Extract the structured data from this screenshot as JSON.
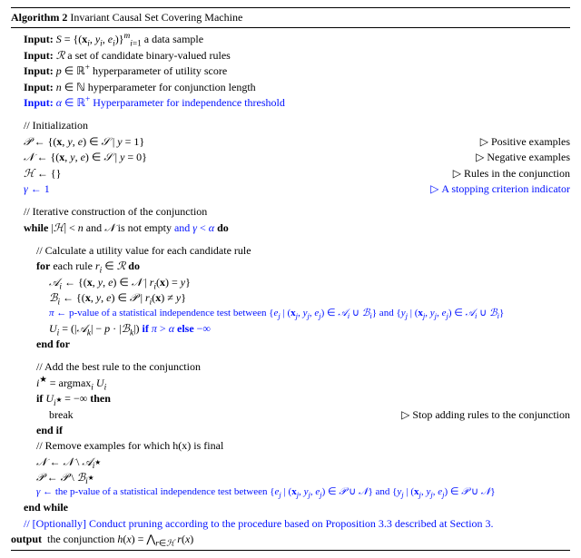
{
  "title_label": "Algorithm 2",
  "title_name": "Invariant Causal Set Covering Machine",
  "inputs": {
    "s": "S = {(xᵢ, yᵢ, eᵢ)}ᵐᵢ₌₁ a data sample",
    "r": "ℛ a set of candidate binary-valued rules",
    "p": "p ∈ ℝ⁺ hyperparameter of utility score",
    "n": "n ∈ ℕ hyperparameter for conjunction length",
    "alpha": "α ∈ ℝ⁺ Hyperparameter for independence threshold"
  },
  "init_comment": "// Initialization",
  "init": {
    "P": "𝒫 ← {(x, y, e) ∈ 𝒮 | y = 1}",
    "N": "𝒩 ← {(x, y, e) ∈ 𝒮 | y = 0}",
    "H": "ℋ ← {}",
    "gamma": "γ ← 1"
  },
  "init_rhs": {
    "P": "Positive examples",
    "N": "Negative examples",
    "H": "Rules in the conjunction",
    "gamma": "A stopping criterion indicator"
  },
  "iter_comment": "// Iterative construction of the conjunction",
  "while_line_a": "while |ℋ| < n and 𝒩 is not empty ",
  "while_line_b": "and γ < α",
  "while_line_c": " do",
  "utility_comment": "// Calculate a utility value for each candidate rule",
  "for_line": "for each rule rᵢ ∈ ℛ do",
  "A_line": "𝒜ᵢ ← {(x, y, e) ∈ 𝒩 | rᵢ(x) = y}",
  "B_line": "ℬᵢ ← {(x, y, e) ∈ 𝒫 | rᵢ(x) ≠ y}",
  "pi_line": "π ← p-value of a statistical independence test between {eⱼ | (xⱼ, yⱼ, eⱼ) ∈ 𝒜ᵢ ∪ ℬᵢ} and {yⱼ | (xⱼ, yⱼ, eⱼ) ∈ 𝒜ᵢ ∪ ℬᵢ}",
  "U_line_a": "Uᵢ = (|𝒜ₖ| − p · |ℬₖ|) ",
  "U_line_b": "if π > α else −∞",
  "endfor": "end for",
  "add_comment": "// Add the best rule to the conjunction",
  "istar": "i* = argmaxᵢ Uᵢ",
  "if_line": "if Uᵢ* = −∞ then",
  "break": "break",
  "break_rhs": "Stop adding rules to the conjunction",
  "endif": "end if",
  "remove_comment": "// Remove examples for which h(x) is final",
  "N_update": "𝒩 ← 𝒩 \\ 𝒜ᵢ*",
  "P_update": "𝒫 ← 𝒫 \\ ℬᵢ*",
  "gamma_update": "γ ← the p-value of a statistical independence test between {eⱼ | (xⱼ, yⱼ, eⱼ) ∈ 𝒫 ∪ 𝒩} and {yⱼ | (xⱼ, yⱼ, eⱼ) ∈ 𝒫 ∪ 𝒩}",
  "endwhile": "end while",
  "prune_comment": "// [Optionally] Conduct pruning according to the procedure based on Proposition 3.3 described at Section 3.",
  "output": "output  the conjunction h(x) = ⋀_{r∈ℋ} r(x)",
  "keywords": {
    "input": "Input:"
  }
}
